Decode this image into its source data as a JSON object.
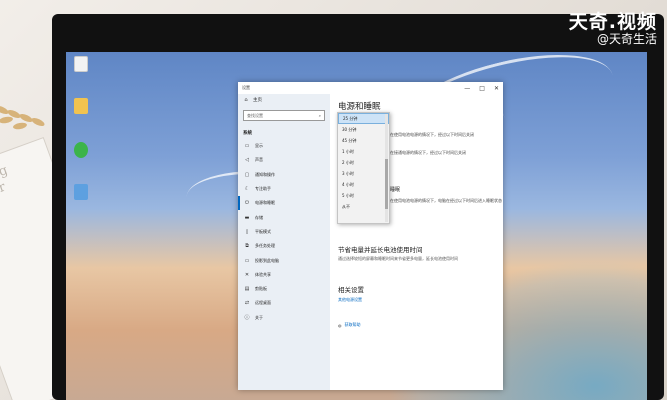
{
  "watermark": {
    "title": "天奇.视频",
    "subtitle": "@天奇生活"
  },
  "paper": {
    "text": "bring your"
  },
  "window": {
    "title": "设置",
    "controls": {
      "minimize": "—",
      "maximize": "□",
      "close": "✕"
    }
  },
  "sidebar": {
    "home": "主页",
    "search_placeholder": "查找设置",
    "section": "系统",
    "items": [
      {
        "label": "显示",
        "icon": "monitor-icon",
        "glyph": "▭"
      },
      {
        "label": "声音",
        "icon": "sound-icon",
        "glyph": "◁"
      },
      {
        "label": "通知和操作",
        "icon": "notification-icon",
        "glyph": "▢"
      },
      {
        "label": "专注助手",
        "icon": "moon-icon",
        "glyph": "☾"
      },
      {
        "label": "电源和睡眠",
        "icon": "power-icon",
        "glyph": "⏻"
      },
      {
        "label": "存储",
        "icon": "storage-icon",
        "glyph": "▬"
      },
      {
        "label": "平板模式",
        "icon": "tablet-icon",
        "glyph": "▯"
      },
      {
        "label": "多任务处理",
        "icon": "multitask-icon",
        "glyph": "⧉"
      },
      {
        "label": "投影到此电脑",
        "icon": "projection-icon",
        "glyph": "▭"
      },
      {
        "label": "体验共享",
        "icon": "share-icon",
        "glyph": "✕"
      },
      {
        "label": "剪贴板",
        "icon": "clipboard-icon",
        "glyph": "▤"
      },
      {
        "label": "远程桌面",
        "icon": "remote-desktop-icon",
        "glyph": "⇄"
      },
      {
        "label": "关于",
        "icon": "info-icon",
        "glyph": "ⓘ"
      }
    ]
  },
  "main": {
    "heading": "电源和睡眠",
    "screen_label": "屏幕",
    "behind_text_1": "在使用电池电源的情况下，经过以下时间后关闭",
    "behind_text_2": "在接通电源的情况下，经过以下时间后关闭",
    "sleep_label": "睡眠",
    "behind_text_3": "在使用电池电源的情况下，电脑在经过以下时间后进入睡眠状态",
    "save_power_title": "节省电量并延长电池使用时间",
    "save_power_desc": "通过选择较短的屏幕和睡眠时间来节省更多电量，延长电池使用时间",
    "related_title": "相关设置",
    "related_link": "其他电源设置",
    "help_link": "获取帮助"
  },
  "dropdown": {
    "options": [
      "25 分钟",
      "30 分钟",
      "45 分钟",
      "1 小时",
      "2 小时",
      "3 小时",
      "4 小时",
      "5 小时",
      "从不"
    ],
    "selected": "25 分钟"
  }
}
